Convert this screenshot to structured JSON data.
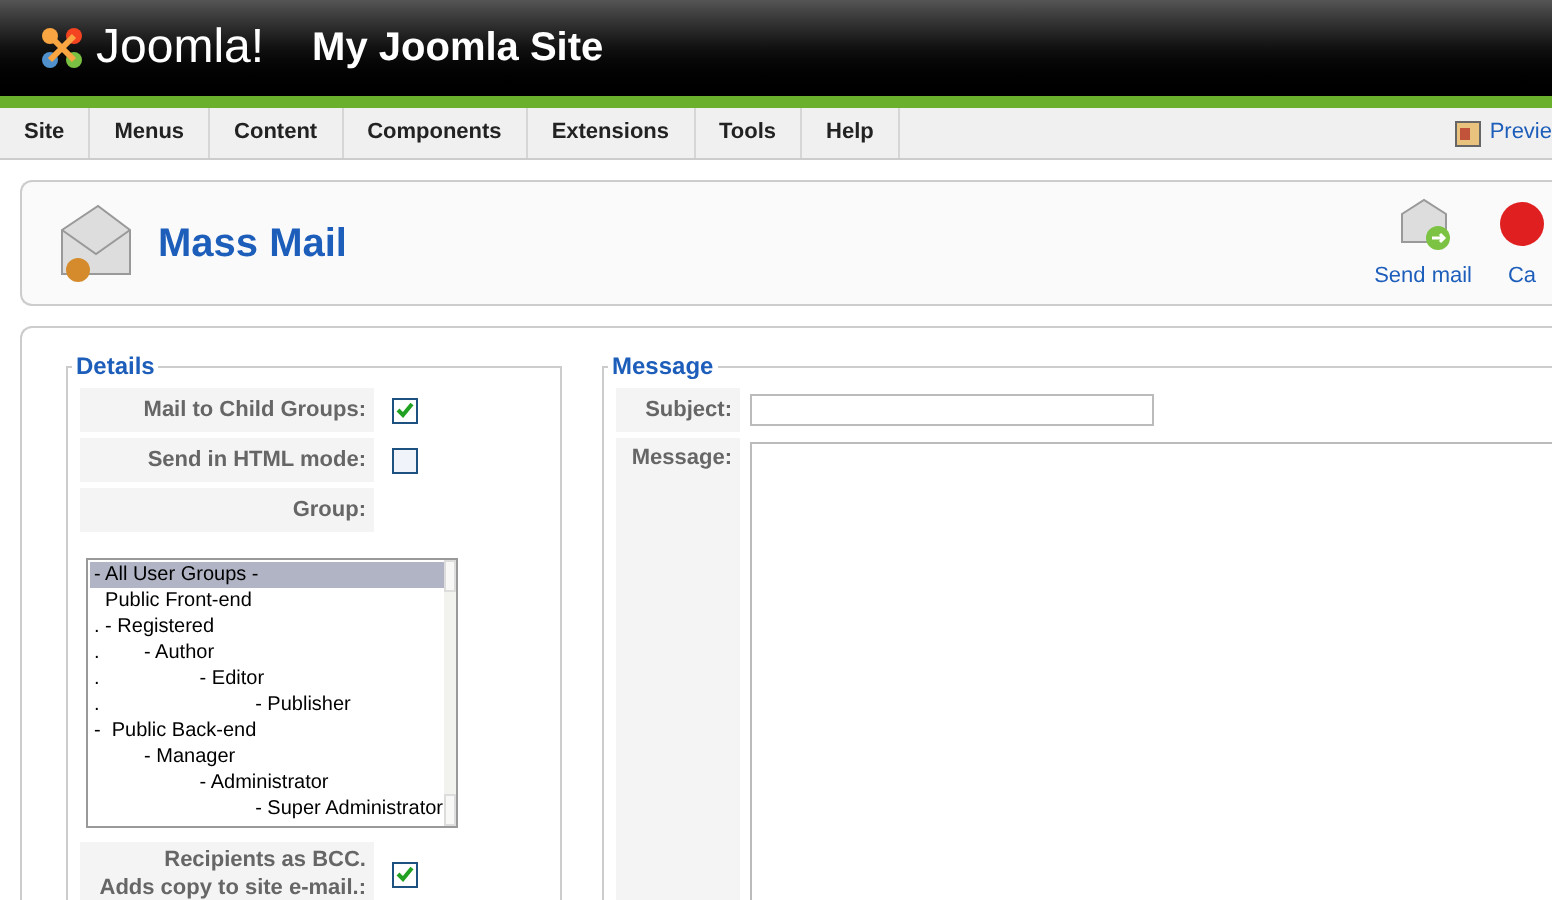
{
  "header": {
    "logo_text": "Joomla!",
    "site_name": "My Joomla Site"
  },
  "menu": {
    "items": [
      {
        "label": "Site"
      },
      {
        "label": "Menus"
      },
      {
        "label": "Content"
      },
      {
        "label": "Components"
      },
      {
        "label": "Extensions"
      },
      {
        "label": "Tools"
      },
      {
        "label": "Help"
      }
    ],
    "preview_link": "Previe"
  },
  "toolbar": {
    "title": "Mass Mail",
    "buttons": [
      {
        "label": "Send mail",
        "kind": "send"
      },
      {
        "label": "Ca",
        "kind": "cancel"
      }
    ]
  },
  "details": {
    "legend": "Details",
    "mail_to_child_groups": {
      "label": "Mail to Child Groups:",
      "checked": true
    },
    "send_html": {
      "label": "Send in HTML mode:",
      "checked": false
    },
    "group": {
      "label": "Group:",
      "options": [
        {
          "label": "- All User Groups -",
          "selected": true
        },
        {
          "label": "  Public Front-end",
          "selected": false
        },
        {
          "label": ". - Registered",
          "selected": false
        },
        {
          "label": ".        - Author",
          "selected": false
        },
        {
          "label": ".                  - Editor",
          "selected": false
        },
        {
          "label": ".                            - Publisher",
          "selected": false
        },
        {
          "label": "-  Public Back-end",
          "selected": false
        },
        {
          "label": "         - Manager",
          "selected": false
        },
        {
          "label": "                   - Administrator",
          "selected": false
        },
        {
          "label": "                             - Super Administrator",
          "selected": false
        }
      ]
    },
    "bcc": {
      "label_lines": [
        "Recipients as BCC.",
        "Adds copy to site e-mail.:"
      ],
      "checked": true
    }
  },
  "message": {
    "legend": "Message",
    "subject": {
      "label": "Subject:"
    },
    "body": {
      "label": "Message:"
    }
  }
}
